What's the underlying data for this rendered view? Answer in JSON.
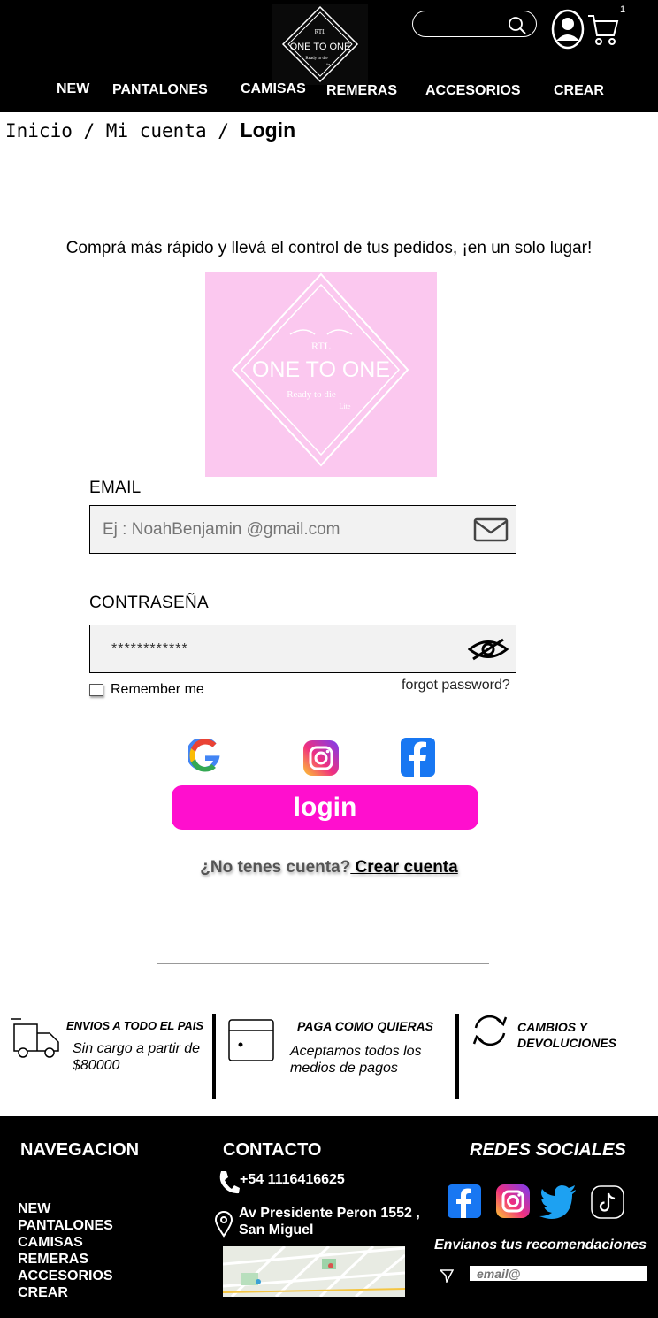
{
  "header": {
    "logo": {
      "badge": "RTL",
      "name": "ONE TO ONE",
      "tagline": "Ready to die",
      "sub": "Lite"
    },
    "cart_count": "1",
    "nav": [
      {
        "label": "NEW"
      },
      {
        "label": "PANTALONES"
      },
      {
        "label": "CAMISAS"
      },
      {
        "label": "REMERAS"
      },
      {
        "label": "ACCESORIOS"
      },
      {
        "label": "CREAR"
      }
    ]
  },
  "breadcrumb": {
    "home": "Inicio",
    "sep1": " / ",
    "account": "Mi cuenta",
    "sep2": " / ",
    "current": "Login"
  },
  "login": {
    "tagline": "Comprá más rápido y llevá el control de tus pedidos, ¡en un solo lugar!",
    "email_label": "EMAIL",
    "email_placeholder": "Ej : NoahBenjamin @gmail.com",
    "password_label": "CONTRASEÑA",
    "password_value": "************",
    "remember": "Remember me",
    "forgot": "forgot password?",
    "button": "login",
    "no_account": "¿No tenes cuenta?",
    "create": " Crear cuenta"
  },
  "features": [
    {
      "title": "ENVIOS A TODO EL PAIS",
      "text": "Sin cargo a partir de $80000"
    },
    {
      "title": "PAGA COMO QUIERAS",
      "text": "Aceptamos todos los medios de pagos"
    },
    {
      "title": "CAMBIOS Y DEVOLUCIONES",
      "text": ""
    }
  ],
  "footer": {
    "nav_title": "NAVEGACION",
    "nav_items": [
      "NEW",
      "PANTALONES",
      "CAMISAS",
      "REMERAS",
      "ACCESORIOS",
      "CREAR"
    ],
    "contact_title": "CONTACTO",
    "phone": "+54 1116416625",
    "address_line1": "Av Presidente Peron 1552 ,",
    "address_line2": "San Miguel",
    "social_title": "REDES SOCIALES",
    "newsletter_label": "Envianos tus recomendaciones",
    "newsletter_placeholder": "email@"
  },
  "colors": {
    "accent": "#ff0fce",
    "logo_bg": "#fbc8ef",
    "header_bg": "#000000"
  }
}
